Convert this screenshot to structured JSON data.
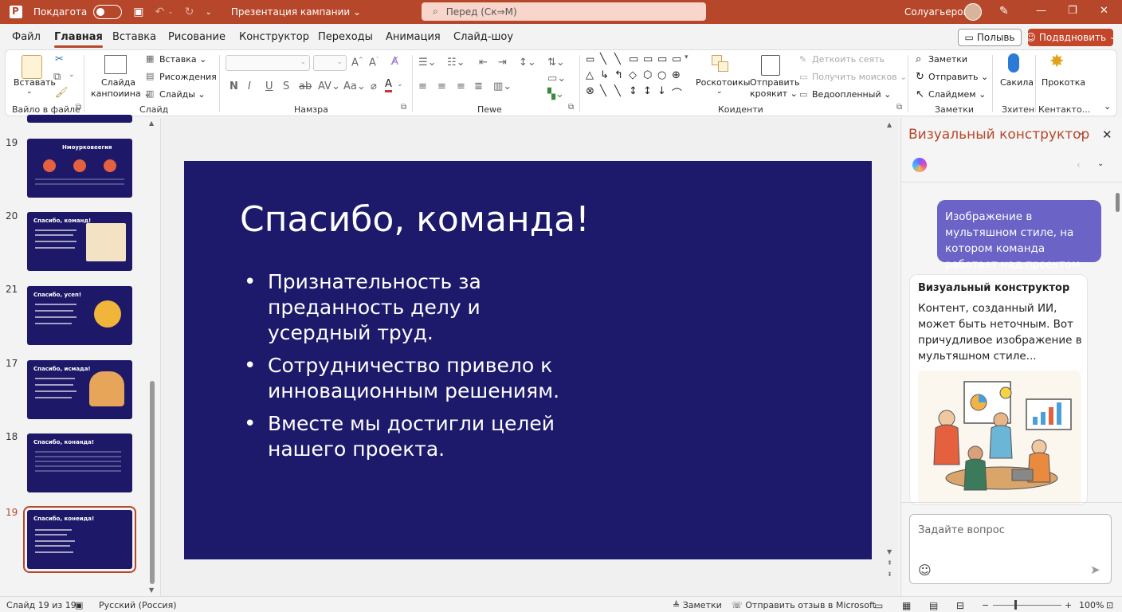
{
  "titlebar": {
    "autosave_label": "Покдаготa",
    "doc_title": "Презентация кампании",
    "search_placeholder": "Перед (Ск⇒М)",
    "user_name": "Солуагьерок"
  },
  "menu": {
    "tabs": [
      "Файл",
      "Главная",
      "Вставка",
      "Рисование",
      "Конструктор",
      "Переходы",
      "Анимация",
      "Слайд-шоу"
    ],
    "active_tab": "Главная",
    "share_label": "Полывь",
    "connect_label": "Подвдновить"
  },
  "ribbon": {
    "paste_label": "Вставать",
    "slide_label": "Слайда",
    "slide_label2": "канпоиина",
    "insert_small": "Вставка",
    "drawing_small": "Рисождения",
    "slides_small": "Слайды",
    "group_clipboard": "Вайло в файле",
    "group_slide": "Слайд",
    "group_font": "Намзра",
    "group_paragraph": "Пеwе",
    "group_drawing": "Коиденти",
    "group_notes": "Заметки",
    "group_voice": "Зхитен",
    "group_addins": "Кентакто...",
    "shapes_label": "Роскотоикы",
    "send_label": "Отправить",
    "send_label2": "кроякит",
    "delete_dim": "Деткоить сеять",
    "receive_dim": "Получить моисков",
    "highlight_label": "Ведоопленный",
    "notes_label": "Заметки",
    "send_small": "Отправить",
    "slidenum_small": "Слайдмем",
    "voice_label": "Сакила",
    "addins_label": "Прокотка"
  },
  "thumbnails": [
    {
      "num": "19",
      "title": "Нмоуркoвеегия"
    },
    {
      "num": "20",
      "title": "Спасибо, команд!"
    },
    {
      "num": "21",
      "title": "Спасибо, усеп!"
    },
    {
      "num": "17",
      "title": "Спасибо, исмада!"
    },
    {
      "num": "18",
      "title": "Спасибо, конанда!"
    },
    {
      "num": "19",
      "title": "Спасибо, конеида!"
    }
  ],
  "slide": {
    "title": "Спасибо, команда!",
    "bullets": [
      "Признательность за преданность делу и усердный труд.",
      "Сотрудничество привело к инновационным решениям.",
      "Вместе мы достигли целей нашего проекта."
    ]
  },
  "designer": {
    "title": "Визуальный конструктор",
    "user_prompt": "Изображение в мультяшном стиле, на котором команда работает над проектом",
    "reply_title": "Визуальный конструктор",
    "reply_text": "Контент, созданный ИИ, может быть неточным. Вот причудливое изображение в мультяшном стиле...",
    "ask_placeholder": "Задайте вопрос"
  },
  "statusbar": {
    "slide_count": "Слайд 19 из 19",
    "language": "Русский (Россия)",
    "notes": "Заметки",
    "feedback": "Отправить отзыв в Microsoft",
    "zoom": "100%"
  },
  "colors": {
    "accent": "#b7472a",
    "slide_bg": "#1d196b",
    "bubble": "#6b63c6"
  }
}
